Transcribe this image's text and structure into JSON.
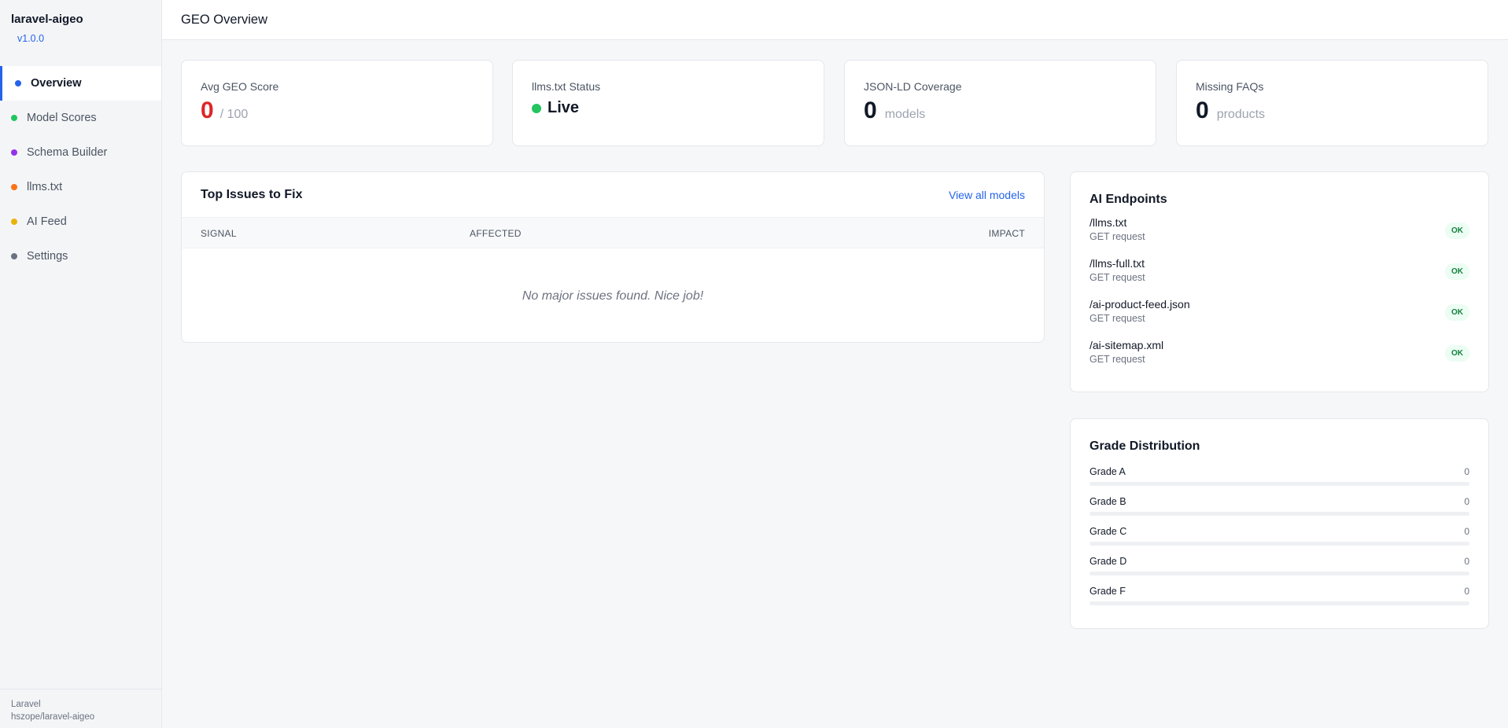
{
  "sidebar": {
    "brand": "laravel-aigeo",
    "version": "v1.0.0",
    "items": [
      {
        "label": "Overview",
        "color": "#2563eb",
        "active": true
      },
      {
        "label": "Model Scores",
        "color": "#22c55e"
      },
      {
        "label": "Schema Builder",
        "color": "#9333ea"
      },
      {
        "label": "llms.txt",
        "color": "#f97316"
      },
      {
        "label": "AI Feed",
        "color": "#eab308"
      },
      {
        "label": "Settings",
        "color": "#6b7280"
      }
    ],
    "footer_line1": "Laravel",
    "footer_line2": "hszope/laravel-aigeo"
  },
  "header": {
    "title": "GEO Overview"
  },
  "stats": {
    "geo_score": {
      "label": "Avg GEO Score",
      "value": "0",
      "suffix": "/ 100"
    },
    "llms_status": {
      "label": "llms.txt Status",
      "value": "Live"
    },
    "jsonld": {
      "label": "JSON-LD Coverage",
      "value": "0",
      "suffix": "models"
    },
    "faqs": {
      "label": "Missing FAQs",
      "value": "0",
      "suffix": "products"
    }
  },
  "issues": {
    "title": "Top Issues to Fix",
    "link": "View all models",
    "columns": {
      "signal": "SIGNAL",
      "affected": "AFFECTED",
      "impact": "IMPACT"
    },
    "empty": "No major issues found. Nice job!"
  },
  "endpoints": {
    "title": "AI Endpoints",
    "items": [
      {
        "path": "/llms.txt",
        "method": "GET request",
        "status": "OK"
      },
      {
        "path": "/llms-full.txt",
        "method": "GET request",
        "status": "OK"
      },
      {
        "path": "/ai-product-feed.json",
        "method": "GET request",
        "status": "OK"
      },
      {
        "path": "/ai-sitemap.xml",
        "method": "GET request",
        "status": "OK"
      }
    ]
  },
  "grades": {
    "title": "Grade Distribution",
    "items": [
      {
        "label": "Grade A",
        "count": "0",
        "fraction": 0
      },
      {
        "label": "Grade B",
        "count": "0",
        "fraction": 0
      },
      {
        "label": "Grade C",
        "count": "0",
        "fraction": 0
      },
      {
        "label": "Grade D",
        "count": "0",
        "fraction": 0
      },
      {
        "label": "Grade F",
        "count": "0",
        "fraction": 0
      }
    ]
  }
}
